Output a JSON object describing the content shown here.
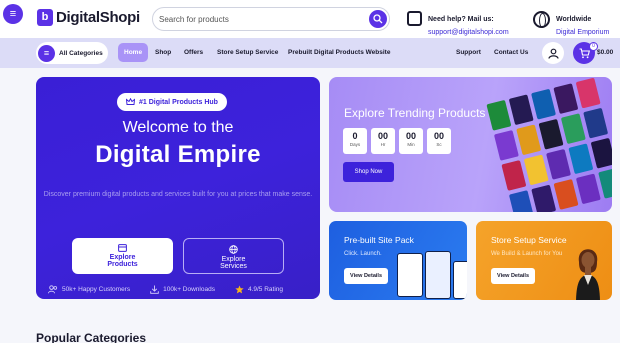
{
  "header": {
    "brand": "DigitalShopi",
    "search_placeholder": "Search for products",
    "help_title": "Need help? Mail us:",
    "help_email": "support@digitalshopi.com",
    "world_title": "Worldwide",
    "world_sub": "Digital Emporium"
  },
  "nav": {
    "categories_label": "All Categories",
    "links": [
      "Home",
      "Shop",
      "Offers",
      "Store Setup Service",
      "Prebuilt Digital Products Website",
      "Support",
      "Contact Us"
    ],
    "active": "Home",
    "cart_count": "0",
    "cart_total": "$0.00"
  },
  "hero": {
    "badge": "#1 Digital Products Hub",
    "title_line1": "Welcome to the",
    "title_line2": "Digital Empire",
    "description": "Discover premium digital products and services built for you at prices that make sense.",
    "btn_products_1": "Explore",
    "btn_products_2": "Products",
    "btn_services_1": "Explore",
    "btn_services_2": "Services",
    "stats": [
      "50k+ Happy Customers",
      "100k+ Downloads",
      "4.9/5 Rating"
    ]
  },
  "trending": {
    "title": "Explore Trending Products",
    "countdown": [
      {
        "value": "0",
        "label": "Days"
      },
      {
        "value": "00",
        "label": "Hr"
      },
      {
        "value": "00",
        "label": "Min"
      },
      {
        "value": "00",
        "label": "Sc"
      }
    ],
    "cta": "Shop Now"
  },
  "site_pack": {
    "title": "Pre-built Site Pack",
    "subtitle": "Click. Launch.",
    "cta": "View Details"
  },
  "store_setup": {
    "title": "Store Setup Service",
    "subtitle": "We Build & Launch for You",
    "cta": "View Details"
  },
  "sections": {
    "popular": "Popular Categories"
  },
  "colors": {
    "primary": "#5b32e6",
    "hero": "#3d22db",
    "trend": "#b39cf8",
    "site_card": "#2470e8",
    "setup_card": "#f29a20"
  }
}
